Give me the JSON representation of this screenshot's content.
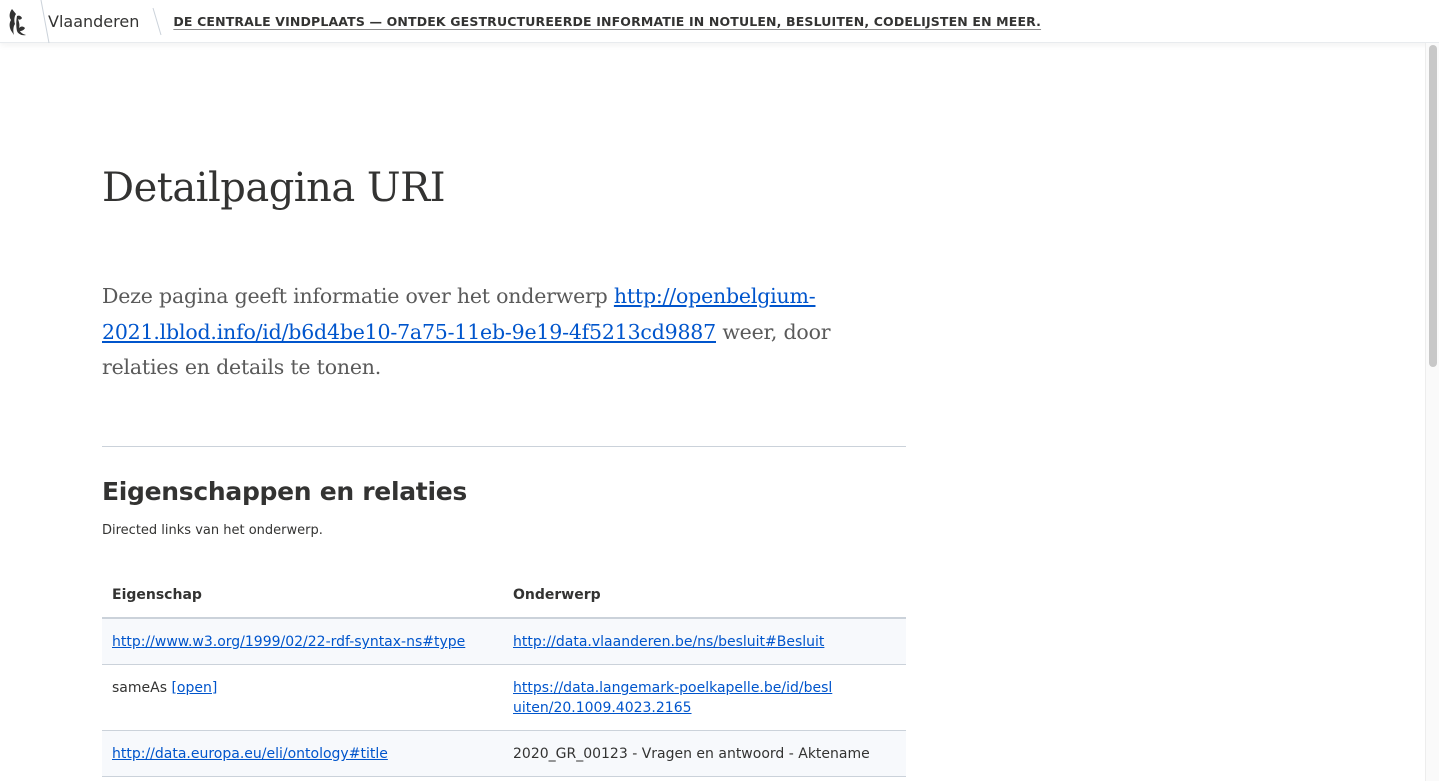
{
  "header": {
    "brand": "Vlaanderen",
    "tagline": "DE CENTRALE VINDPLAATS — ONTDEK GESTRUCTUREERDE INFORMATIE IN NOTULEN, BESLUITEN, CODELIJSTEN EN MEER."
  },
  "page": {
    "title": "Detailpagina URI",
    "intro_before": "Deze pagina geeft informatie over het onderwerp ",
    "intro_link": "http://openbelgium-2021.lblod.info/id/b6d4be10-7a75-11eb-9e19-4f5213cd9887",
    "intro_after": " weer, door relaties en details te tonen."
  },
  "section": {
    "title": "Eigenschappen en relaties",
    "subtitle": "Directed links van het onderwerp."
  },
  "table": {
    "headers": [
      "Eigenschap",
      "Onderwerp"
    ],
    "rows": [
      {
        "property": "http://www.w3.org/1999/02/22-rdf-syntax-ns#type",
        "value": "http://data.vlaanderen.be/ns/besluit#Besluit",
        "value_link": true
      },
      {
        "property": "sameAs",
        "property_action": "[open]",
        "value": "https://data.langemark-poelkapelle.be/id/besluiten/20.1009.4023.2165",
        "value_link": true
      },
      {
        "property": "http://data.europa.eu/eli/ontology#title",
        "value": "2020_GR_00123 - Vragen en antwoord - Aktename",
        "value_link": false
      }
    ]
  }
}
